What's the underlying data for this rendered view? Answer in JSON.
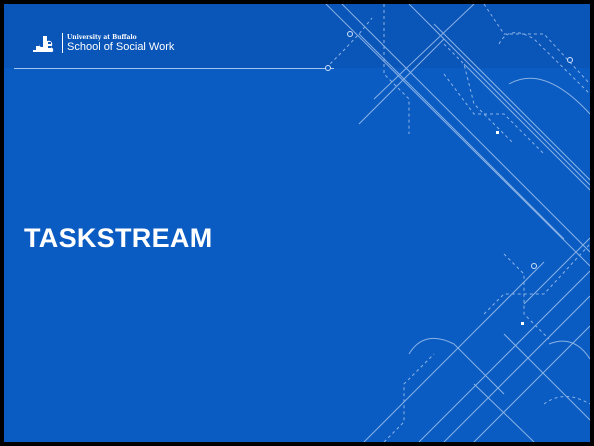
{
  "header": {
    "university": "University at Buffalo",
    "school": "School of Social Work"
  },
  "slide": {
    "title": "TASKSTREAM"
  },
  "colors": {
    "background": "#0b5cc2",
    "header_band": "#0a55b8",
    "text": "#ffffff",
    "line_art": "#a9c8f0"
  },
  "icons": {
    "logo": "ub-logo-icon",
    "decoration": "circuit-line-art"
  }
}
